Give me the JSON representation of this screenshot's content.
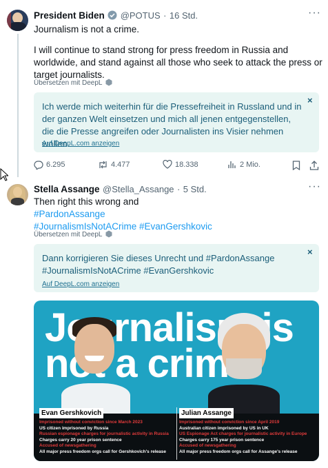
{
  "tweet1": {
    "name": "President Biden",
    "handle": "@POTUS",
    "sep": "·",
    "time": "16 Std.",
    "line1": "Journalism is not a crime.",
    "para": "I will continue to stand strong for press freedom in Russia and worldwide, and stand against all those who seek to attack the press or target journalists.",
    "translate": "Übersetzen mit DeepL",
    "translation": "Ich werde mich weiterhin für die Pressefreiheit in Russland und in der ganzen Welt einsetzen und mich all jenen entgegenstellen, die die Presse angreifen oder Journalisten ins Visier nehmen wollen.",
    "deepl_link": "Auf DeepL.com anzeigen",
    "close": "×",
    "replies": "6.295",
    "retweets": "4.477",
    "likes": "18.338",
    "views": "2 Mio."
  },
  "tweet2": {
    "name": "Stella Assange",
    "handle": "@Stella_Assange",
    "sep": "·",
    "time": "5 Std.",
    "line1": "Then right this wrong and",
    "hashtag1": "#PardonAssange",
    "hashtag2": "#JournalismIsNotACrime #EvanGershkovic",
    "translate": "Übersetzen mit DeepL",
    "translation_l1": "Dann korrigieren Sie dieses Unrecht und #PardonAssange",
    "translation_l2": "#JournalismIsNotACrime #EvanGershkovic",
    "deepl_link": "Auf DeepL.com anzeigen",
    "close": "×"
  },
  "image": {
    "headline_l1": "Journalism is",
    "headline_l2": "not a crime",
    "left": {
      "name": "Evan Gershkovich",
      "lines": [
        {
          "text": "Imprisoned without conviction since March 2023",
          "color": "red"
        },
        {
          "text": "US citizen imprisoned by Russia",
          "color": "white"
        },
        {
          "text": "Russian espionage charges for journalistic activity in Russia",
          "color": "red"
        },
        {
          "text": "Charges carry 20 year prison sentence",
          "color": "white"
        },
        {
          "text": "Accused of newsgathering",
          "color": "red"
        },
        {
          "text": "All major press freedom orgs call for Gershkovich's release",
          "color": "white"
        }
      ]
    },
    "right": {
      "name": "Julian Assange",
      "lines": [
        {
          "text": "Imprisoned without conviction since April 2019",
          "color": "red"
        },
        {
          "text": "Australian citizen imprisoned by US in UK",
          "color": "white"
        },
        {
          "text": "US Espionage Act charges for journalistic activity in Europe",
          "color": "red"
        },
        {
          "text": "Charges carry 175 year prison sentence",
          "color": "white"
        },
        {
          "text": "Accused of newsgathering",
          "color": "red"
        },
        {
          "text": "All major press freedom orgs call for Assange's release",
          "color": "white"
        }
      ]
    }
  },
  "colors": {
    "accent": "#1d9bf0",
    "translation_bg": "#e8f5f3",
    "card_bg": "#1fa3c3",
    "red_text": "#e23b3b"
  }
}
